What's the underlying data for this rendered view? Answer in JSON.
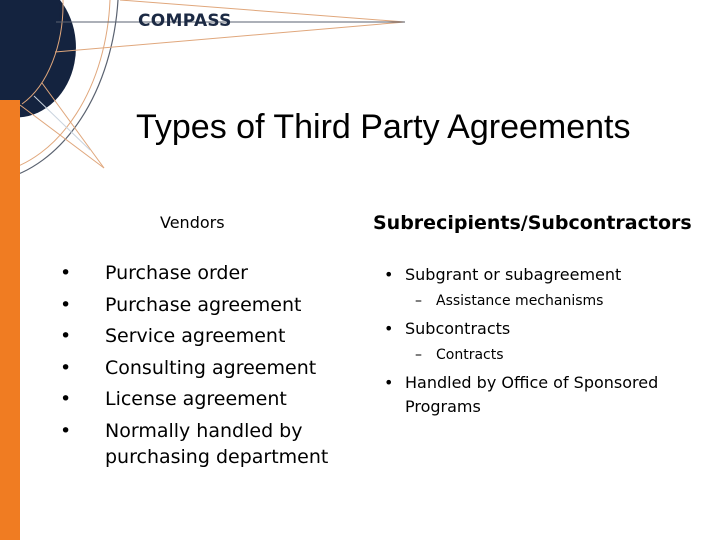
{
  "brand": {
    "logo_text": "COMPASS",
    "colors": {
      "navy": "#14233f",
      "orange": "#f07c22",
      "line_orange": "#e0a77c",
      "line_gray": "#5a6270"
    }
  },
  "slide": {
    "title": "Types of Third Party Agreements",
    "left_column": {
      "heading": "Vendors",
      "bullet_glyph": "•",
      "items": [
        "Purchase order",
        "Purchase agreement",
        "Service agreement",
        "Consulting agreement",
        "License agreement",
        "Normally handled by purchasing department"
      ]
    },
    "right_column": {
      "heading": "Subrecipients/Subcontractors",
      "bullet_glyph": "•",
      "sub_glyph": "–",
      "items": [
        {
          "label": "Subgrant or subagreement",
          "sub": "Assistance mechanisms"
        },
        {
          "label": "Subcontracts",
          "sub": "Contracts"
        },
        {
          "label": "Handled by Office of Sponsored Programs",
          "sub": null
        }
      ]
    }
  }
}
